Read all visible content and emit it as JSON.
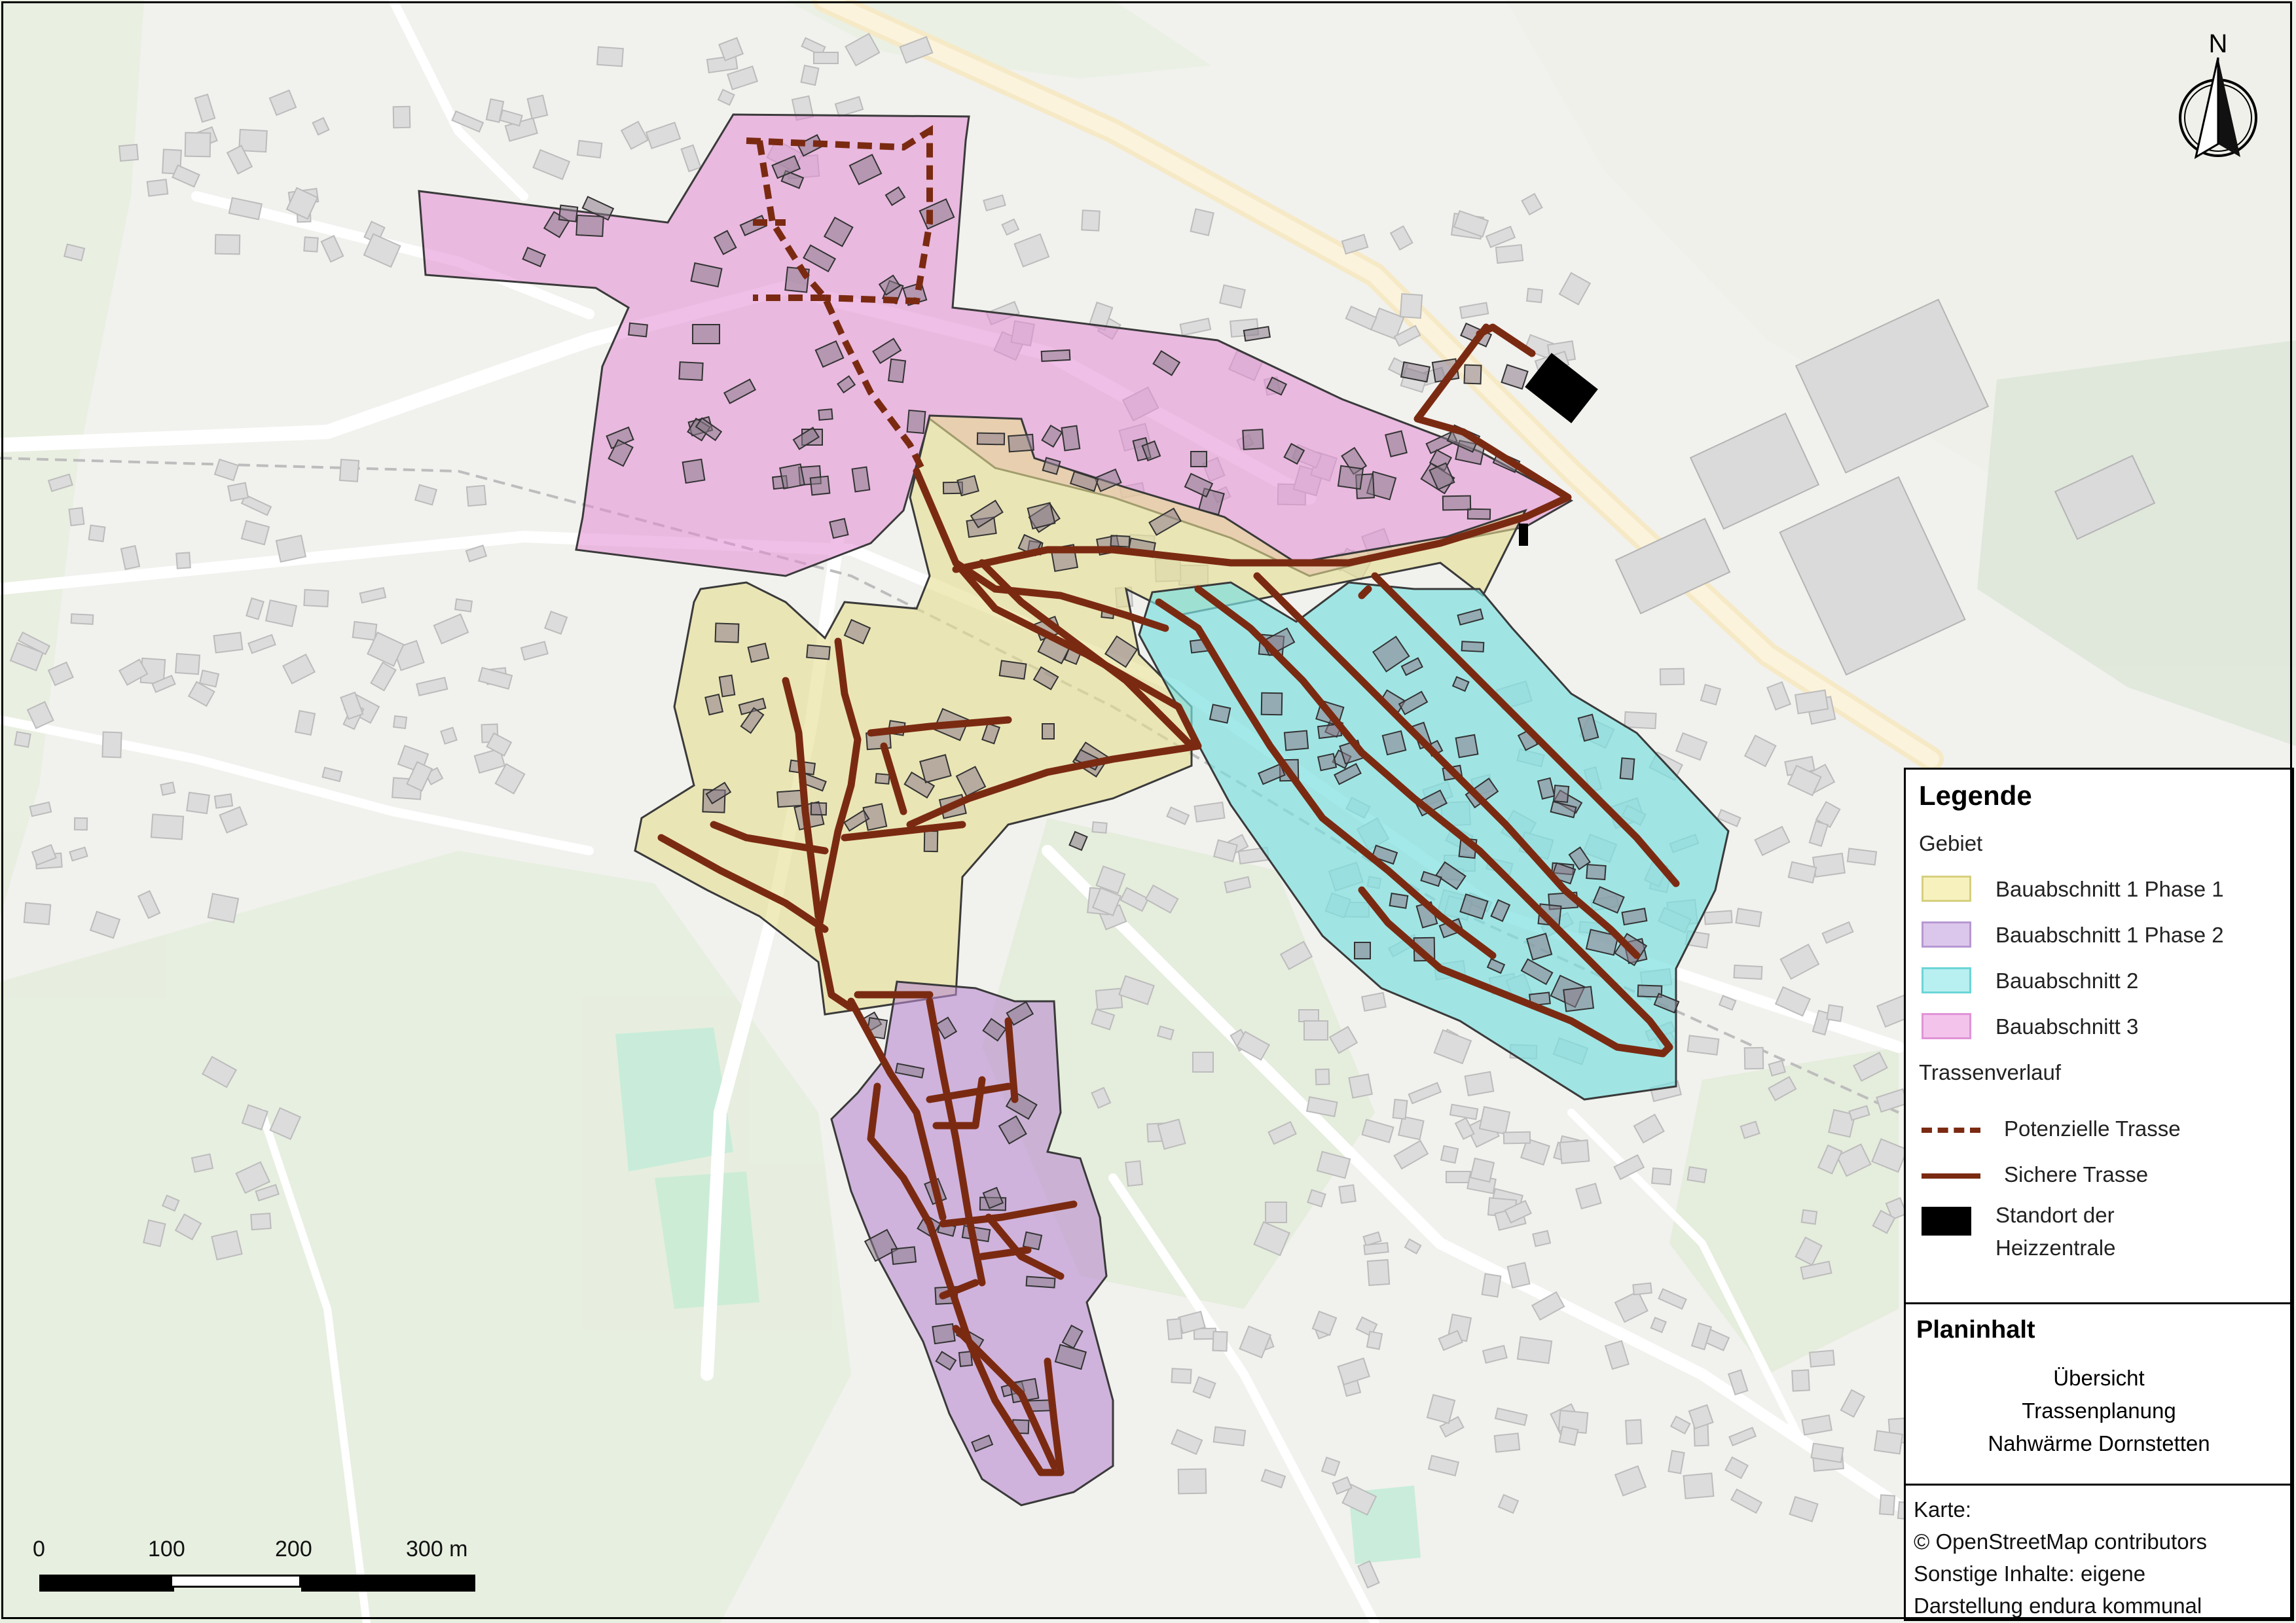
{
  "map": {
    "north_arrow_label": "N",
    "scale": {
      "labels": [
        "0",
        "100",
        "200",
        "300 m"
      ]
    },
    "areas": [
      {
        "name": "Bauabschnitt 1 Phase 1",
        "color": "#ede7a8"
      },
      {
        "name": "Bauabschnitt 1 Phase 2",
        "color": "#c9a5dc"
      },
      {
        "name": "Bauabschnitt 2",
        "color": "#8fe3e0"
      },
      {
        "name": "Bauabschnitt 3",
        "color": "#e89ad9"
      }
    ],
    "trasse_color": "#7b2a12",
    "heizzentrale_color": "#000000"
  },
  "legend": {
    "title": "Legende",
    "gebiet_header": "Gebiet",
    "gebiet_items": [
      {
        "label": "Bauabschnitt 1 Phase 1",
        "fill": "#f6f1bd",
        "border": "#d6cf7e"
      },
      {
        "label": "Bauabschnitt 1 Phase 2",
        "fill": "#dcc7ec",
        "border": "#b698d2"
      },
      {
        "label": "Bauabschnitt 2",
        "fill": "#b8eff0",
        "border": "#6cd5d6"
      },
      {
        "label": "Bauabschnitt 3",
        "fill": "#f3c3ec",
        "border": "#e093d6"
      }
    ],
    "trassen_header": "Trassenverlauf",
    "trassen_items": [
      {
        "label": "Potenzielle Trasse",
        "style": "dashed"
      },
      {
        "label": "Sichere Trasse",
        "style": "solid"
      }
    ],
    "standort_label_line1": "Standort der",
    "standort_label_line2": "Heizzentrale"
  },
  "planinhalt": {
    "title": "Planinhalt",
    "line1": "Übersicht",
    "line2": "Trassenplanung",
    "line3": "Nahwärme Dornstetten"
  },
  "credits": {
    "line1": "Karte:",
    "line2": "© OpenStreetMap contributors",
    "line3": "Sonstige Inhalte: eigene",
    "line4": "Darstellung endura kommunal"
  }
}
